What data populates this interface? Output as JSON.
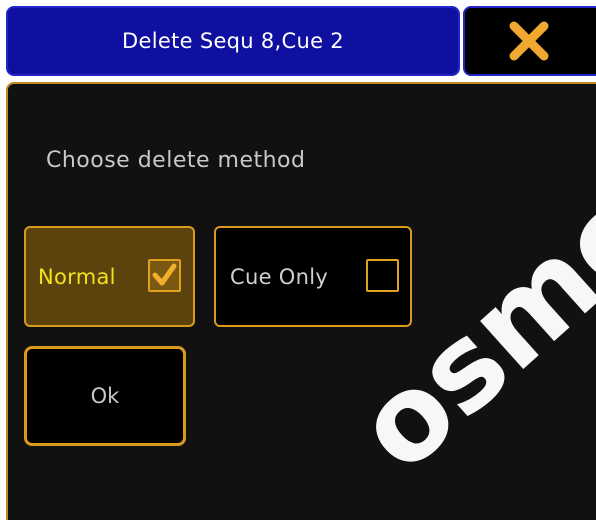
{
  "dialog": {
    "title": "Delete Sequ 8,Cue 2",
    "close_icon": "close-x-icon",
    "prompt": "Choose delete method",
    "options": [
      {
        "label": "Normal",
        "checked": true,
        "check_icon": "checkmark-icon"
      },
      {
        "label": "Cue Only",
        "checked": false
      }
    ],
    "ok_label": "Ok"
  },
  "watermark": {
    "text": "osme"
  },
  "colors": {
    "title_bar": "#0f0fa0",
    "title_border": "#2424c8",
    "accent": "#d99a1c",
    "selected_fill": "#5c420c",
    "selected_text": "#f2e21a",
    "close_icon": "#f0a830",
    "body_bg": "#111111"
  }
}
